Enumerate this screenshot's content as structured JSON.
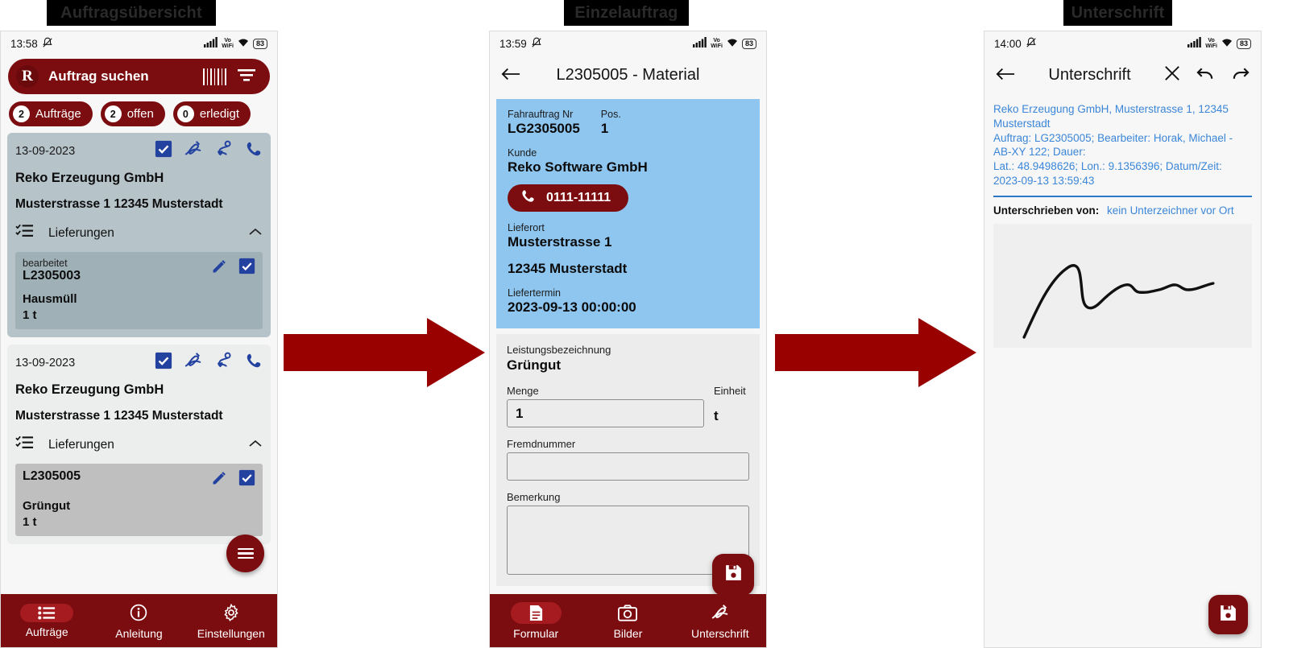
{
  "captions": [
    {
      "label": "Auftragsübersicht"
    },
    {
      "label": "Einzelauftrag"
    },
    {
      "label": "Unterschrift"
    }
  ],
  "colors": {
    "brand_dark_red": "#7b0d10",
    "arrow_red": "#990000",
    "accent_blue": "#2342a0",
    "info_card_blue": "#8ec6f0",
    "link_blue": "#3b86d8",
    "selected_card": "#b6c3c9",
    "plain_card": "#eceded"
  },
  "screen1": {
    "status": {
      "time": "13:58",
      "mute_icon": "bell-muted-icon",
      "signal_icon": "signal-bars-icon",
      "vo": "Vo",
      "wifi_text": "WiFi",
      "wifi_icon": "wifi-icon",
      "battery": "83"
    },
    "search": {
      "logo": "R",
      "label": "Auftrag suchen",
      "barcode_icon": "barcode-icon",
      "filter_icon": "filter-icon"
    },
    "pills": [
      {
        "count": "2",
        "label": "Aufträge"
      },
      {
        "count": "2",
        "label": "offen"
      },
      {
        "count": "0",
        "label": "erledigt"
      }
    ],
    "orders": [
      {
        "date": "13-09-2023",
        "customer": "Reko Erzeugung GmbH",
        "address": "Musterstrasse 1   12345   Musterstadt",
        "deliveries_label": "Lieferungen",
        "icons": [
          "check-box-icon",
          "signature-icon",
          "route-icon",
          "phone-icon"
        ],
        "chevron": "chevron-up-icon",
        "delivery": {
          "status": "bearbeitet",
          "number": "L2305003",
          "material": "Hausmüll",
          "quantity": "1   t",
          "edit_icon": "pencil-icon",
          "check_icon": "check-box-icon"
        }
      },
      {
        "date": "13-09-2023",
        "customer": "Reko Erzeugung GmbH",
        "address": "Musterstrasse 1   12345   Musterstadt",
        "deliveries_label": "Lieferungen",
        "icons": [
          "check-box-icon",
          "signature-icon",
          "route-icon",
          "phone-icon"
        ],
        "chevron": "chevron-up-icon",
        "delivery": {
          "status": "",
          "number": "L2305005",
          "material": "Grüngut",
          "quantity": "1   t",
          "edit_icon": "pencil-icon",
          "check_icon": "check-box-icon"
        }
      }
    ],
    "fab": {
      "icon": "hamburger-menu-icon"
    },
    "bottomnav": [
      {
        "label": "Aufträge",
        "icon": "list-icon",
        "active": true
      },
      {
        "label": "Anleitung",
        "icon": "info-icon",
        "active": false
      },
      {
        "label": "Einstellungen",
        "icon": "gear-icon",
        "active": false
      }
    ]
  },
  "screen2": {
    "status": {
      "time": "13:59",
      "vo": "Vo",
      "wifi_text": "WiFi",
      "battery": "83"
    },
    "appbar": {
      "back_icon": "back-arrow-icon",
      "title": "L2305005 - Material"
    },
    "info": {
      "order_no_label": "Fahrauftrag Nr",
      "order_no_value": "LG2305005",
      "pos_label": "Pos.",
      "pos_value": "1",
      "customer_label": "Kunde",
      "customer_value": "Reko Software GmbH",
      "phone_number": "0111-11111",
      "phone_icon": "phone-icon",
      "delivery_place_label": "Lieferort",
      "delivery_street": "Musterstrasse 1",
      "delivery_city": "12345   Musterstadt",
      "delivery_date_label": "Liefertermin",
      "delivery_date_value": "2023-09-13 00:00:00"
    },
    "form": {
      "service_label": "Leistungsbezeichnung",
      "service_value": "Grüngut",
      "amount_label": "Menge",
      "amount_value": "1",
      "unit_label": "Einheit",
      "unit_value": "t",
      "foreign_no_label": "Fremdnummer",
      "foreign_no_value": "",
      "remark_label": "Bemerkung",
      "remark_value": "",
      "save_icon": "save-icon"
    },
    "bottomnav": [
      {
        "label": "Formular",
        "icon": "document-icon",
        "active": true
      },
      {
        "label": "Bilder",
        "icon": "camera-icon",
        "active": false
      },
      {
        "label": "Unterschrift",
        "icon": "signature-icon",
        "active": false
      }
    ]
  },
  "screen3": {
    "status": {
      "time": "14:00",
      "vo": "Vo",
      "wifi_text": "WiFi",
      "battery": "83"
    },
    "appbar": {
      "back_icon": "back-arrow-icon",
      "title": "Unterschrift",
      "close_icon": "close-icon",
      "undo_icon": "undo-icon",
      "redo_icon": "redo-icon"
    },
    "info_lines": [
      "Reko Erzeugung GmbH, Musterstrasse 1, 12345 Musterstadt",
      "Auftrag: LG2305005; Bearbeiter: Horak, Michael - AB-XY 122; Dauer:",
      "Lat.: 48.9498626; Lon.: 9.1356396; Datum/Zeit: 2023-09-13 13:59:43"
    ],
    "signed_by_label": "Unterschrieben von:",
    "signed_by_value": "kein Unterzeichner vor Ort",
    "signature_pad": "signature-canvas",
    "save_icon": "save-icon"
  }
}
